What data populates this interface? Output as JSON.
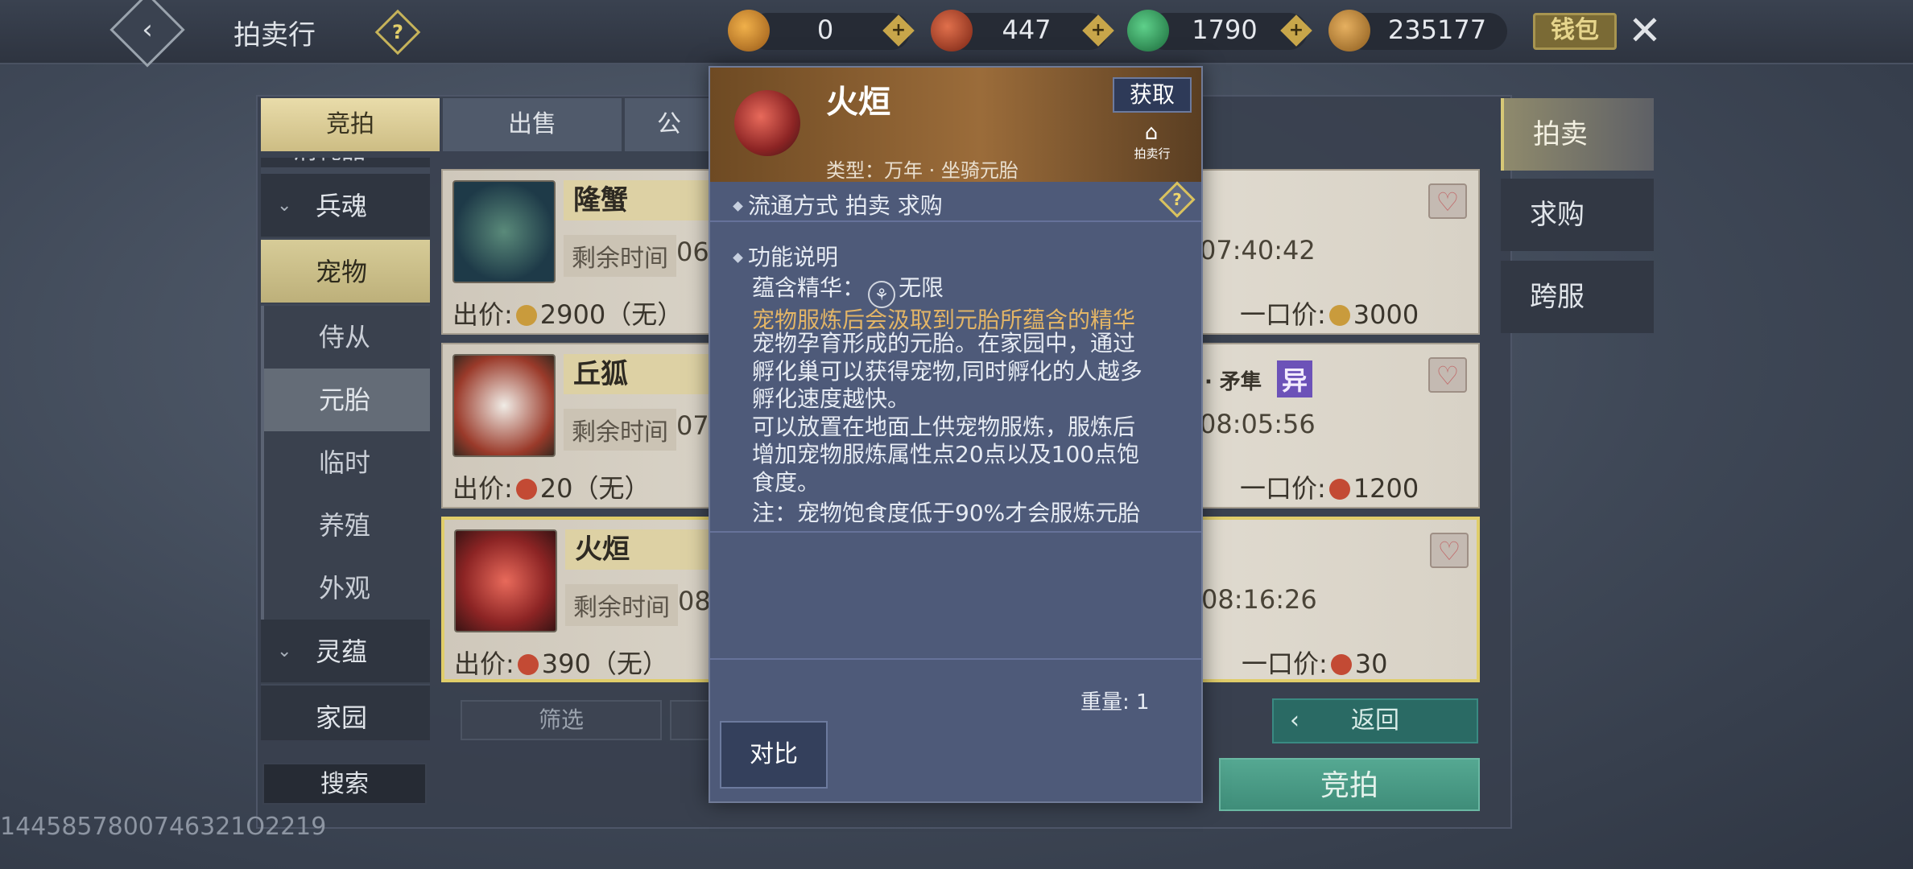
{
  "header": {
    "title": "拍卖行",
    "wallet_label": "钱包"
  },
  "currencies": [
    {
      "name": "yellow-token",
      "value": "0",
      "color": "#c9862a"
    },
    {
      "name": "red-coin",
      "value": "447",
      "color": "#b8462e"
    },
    {
      "name": "jade",
      "value": "1790",
      "color": "#2f9a5c"
    },
    {
      "name": "gold-ingot",
      "value": "235177",
      "color": "#b88a3a"
    }
  ],
  "tabs": [
    "竞拍",
    "出售",
    "公"
  ],
  "categories": {
    "top_partial": "消耗品",
    "items": [
      {
        "label": "兵魂",
        "type": "main",
        "chev": "⌄"
      },
      {
        "label": "宠物",
        "type": "main-active"
      },
      {
        "label": "侍从",
        "type": "sub"
      },
      {
        "label": "元胎",
        "type": "sub-active"
      },
      {
        "label": "临时",
        "type": "sub"
      },
      {
        "label": "养殖",
        "type": "sub"
      },
      {
        "label": "外观",
        "type": "sub"
      },
      {
        "label": "灵蕴",
        "type": "main",
        "chev": "⌄"
      },
      {
        "label": "家园",
        "type": "main"
      }
    ]
  },
  "listings": [
    {
      "name": "隆蟹",
      "time_label": "剩余时间",
      "time_partial": "06:",
      "remaining": "07:40:42",
      "bid_label": "出价:",
      "bid": "2900（无）",
      "bid_coin": "#c99b3c",
      "bo_label": "一口价:",
      "bo": "3000",
      "bo_coin": "#c99b3c"
    },
    {
      "name": "丘狐",
      "time_label": "剩余时间",
      "time_partial": "07:",
      "remaining": "08:05:56",
      "bid_label": "出价:",
      "bid": "20（无）",
      "bid_coin": "#c34a34",
      "bo_label": "一口价:",
      "bo": "1200",
      "bo_coin": "#c34a34",
      "extra": "· 矛隼",
      "tag": "异"
    },
    {
      "name": "火烜",
      "time_label": "剩余时间",
      "time_partial": "08:",
      "remaining": "08:16:26",
      "bid_label": "出价:",
      "bid": "390（无）",
      "bid_coin": "#c34a34",
      "bo_label": "一口价:",
      "bo": "30",
      "bo_coin": "#c34a34"
    }
  ],
  "buttons": {
    "filter": "筛选",
    "search": "搜索",
    "return": "返回",
    "bid": "竞拍"
  },
  "right_tabs": [
    "拍卖",
    "求购",
    "跨服"
  ],
  "uid": "1445857800746321O2219",
  "popup": {
    "name": "火烜",
    "get_label": "获取",
    "source_label": "拍卖行",
    "type": "类型：万年 · 坐骑元胎",
    "circulation": "流通方式    拍卖  求购",
    "section_title": "功能说明",
    "essence_label": "蕴含精华：",
    "essence_value": "无限",
    "gold_line": "宠物服炼后会汲取到元胎所蕴含的精华",
    "desc_lines": [
      "宠物孕育形成的元胎。在家园中，通过",
      "孵化巢可以获得宠物,同时孵化的人越多",
      "孵化速度越快。",
      "可以放置在地面上供宠物服炼，服炼后",
      "增加宠物服炼属性点20点以及100点饱",
      "食度。"
    ],
    "note": "注：宠物饱食度低于90%才会服炼元胎",
    "weight": "重量: 1",
    "compare_label": "对比"
  }
}
